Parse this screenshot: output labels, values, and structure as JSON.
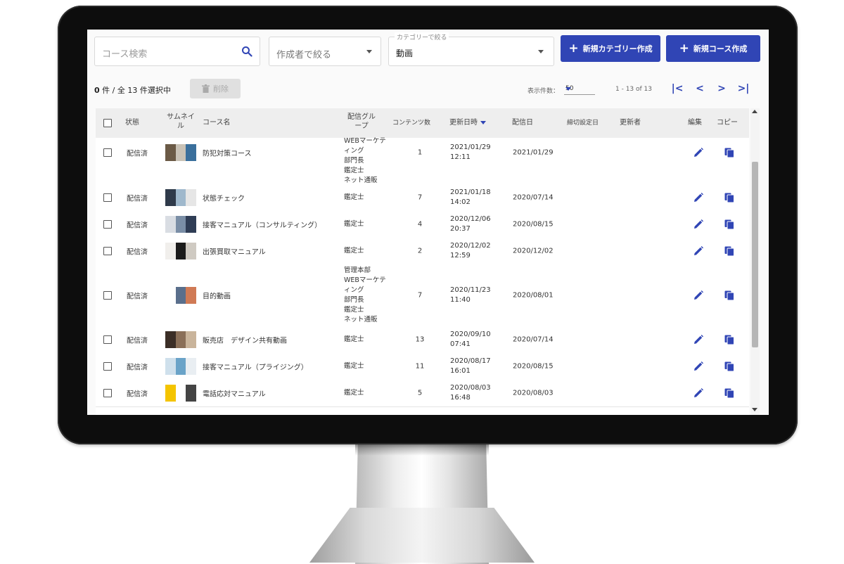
{
  "toolbar": {
    "search_placeholder": "コース検索",
    "creator_filter_placeholder": "作成者で絞る",
    "category_filter_label": "カテゴリーで絞る",
    "category_filter_value": "動画",
    "new_category_button": "新規カテゴリー作成",
    "new_course_button": "新規コース作成",
    "accent_color": "#3045b5"
  },
  "selection": {
    "selected": "0",
    "mid": "件 / 全",
    "total": "13",
    "suffix": "件選択中",
    "delete_button": "削除"
  },
  "pagination": {
    "page_size_label": "表示件数：",
    "page_size_value": "50",
    "range": "1 - 13 of 13",
    "first": "|<",
    "prev": "<",
    "next": ">",
    "last": ">|"
  },
  "table": {
    "headers": {
      "status": "状態",
      "thumbnail": "サムネイ\nル",
      "course_name": "コース名",
      "groups": "配信グル\nープ",
      "content_count": "コンテンツ数",
      "updated_at": "更新日時",
      "published_at": "配信日",
      "deadline": "締切設定日",
      "updated_by": "更新者",
      "edit": "編集",
      "copy": "コピー"
    },
    "rows": [
      {
        "status": "配信済",
        "name": "防犯対策コース",
        "groups": "WEBマーケテ\nィング\n部門長\n鑑定士\nネット通販",
        "count": "1",
        "updated": "2021/01/29\n12:11",
        "published": "2021/01/29",
        "thumb_colors": [
          "#6b5a46",
          "#c9c2b6",
          "#3a6f9c"
        ]
      },
      {
        "status": "配信済",
        "name": "状態チェック",
        "groups": "鑑定士",
        "count": "7",
        "updated": "2021/01/18\n14:02",
        "published": "2020/07/14",
        "thumb_colors": [
          "#2f3a4a",
          "#9fb8cc",
          "#e6e6e6"
        ]
      },
      {
        "status": "配信済",
        "name": "接客マニュアル（コンサルティング）",
        "groups": "鑑定士",
        "count": "4",
        "updated": "2020/12/06\n20:37",
        "published": "2020/08/15",
        "thumb_colors": [
          "#d9dde3",
          "#7a8ea6",
          "#2f3d55"
        ]
      },
      {
        "status": "配信済",
        "name": "出張買取マニュアル",
        "groups": "鑑定士",
        "count": "2",
        "updated": "2020/12/02\n12:59",
        "published": "2020/12/02",
        "thumb_colors": [
          "#f1efec",
          "#1b1b1b",
          "#cfcac2"
        ]
      },
      {
        "status": "配信済",
        "name": "目的動画",
        "groups": "管理本部\nWEBマーケテ\nィング\n部門長\n鑑定士\nネット通販",
        "count": "7",
        "updated": "2020/11/23\n11:40",
        "published": "2020/08/01",
        "thumb_colors": [
          "#ffffff",
          "#5a6f8c",
          "#d07a55"
        ]
      },
      {
        "status": "配信済",
        "name": "販売店　デザイン共有動画",
        "groups": "鑑定士",
        "count": "13",
        "updated": "2020/09/10\n07:41",
        "published": "2020/07/14",
        "thumb_colors": [
          "#3b2e26",
          "#8a6f58",
          "#c9b49b"
        ]
      },
      {
        "status": "配信済",
        "name": "接客マニュアル（プライジング）",
        "groups": "鑑定士",
        "count": "11",
        "updated": "2020/08/17\n16:01",
        "published": "2020/08/15",
        "thumb_colors": [
          "#cfe0ec",
          "#6aa3c8",
          "#e9eef2"
        ]
      },
      {
        "status": "配信済",
        "name": "電話応対マニュアル",
        "groups": "鑑定士",
        "count": "5",
        "updated": "2020/08/03\n16:48",
        "published": "2020/08/03",
        "thumb_colors": [
          "#f4c400",
          "#ffffff",
          "#444444"
        ]
      }
    ]
  },
  "icons": {
    "search": "search-icon",
    "edit": "pencil-icon",
    "copy": "copy-icon",
    "delete": "trash-icon"
  }
}
